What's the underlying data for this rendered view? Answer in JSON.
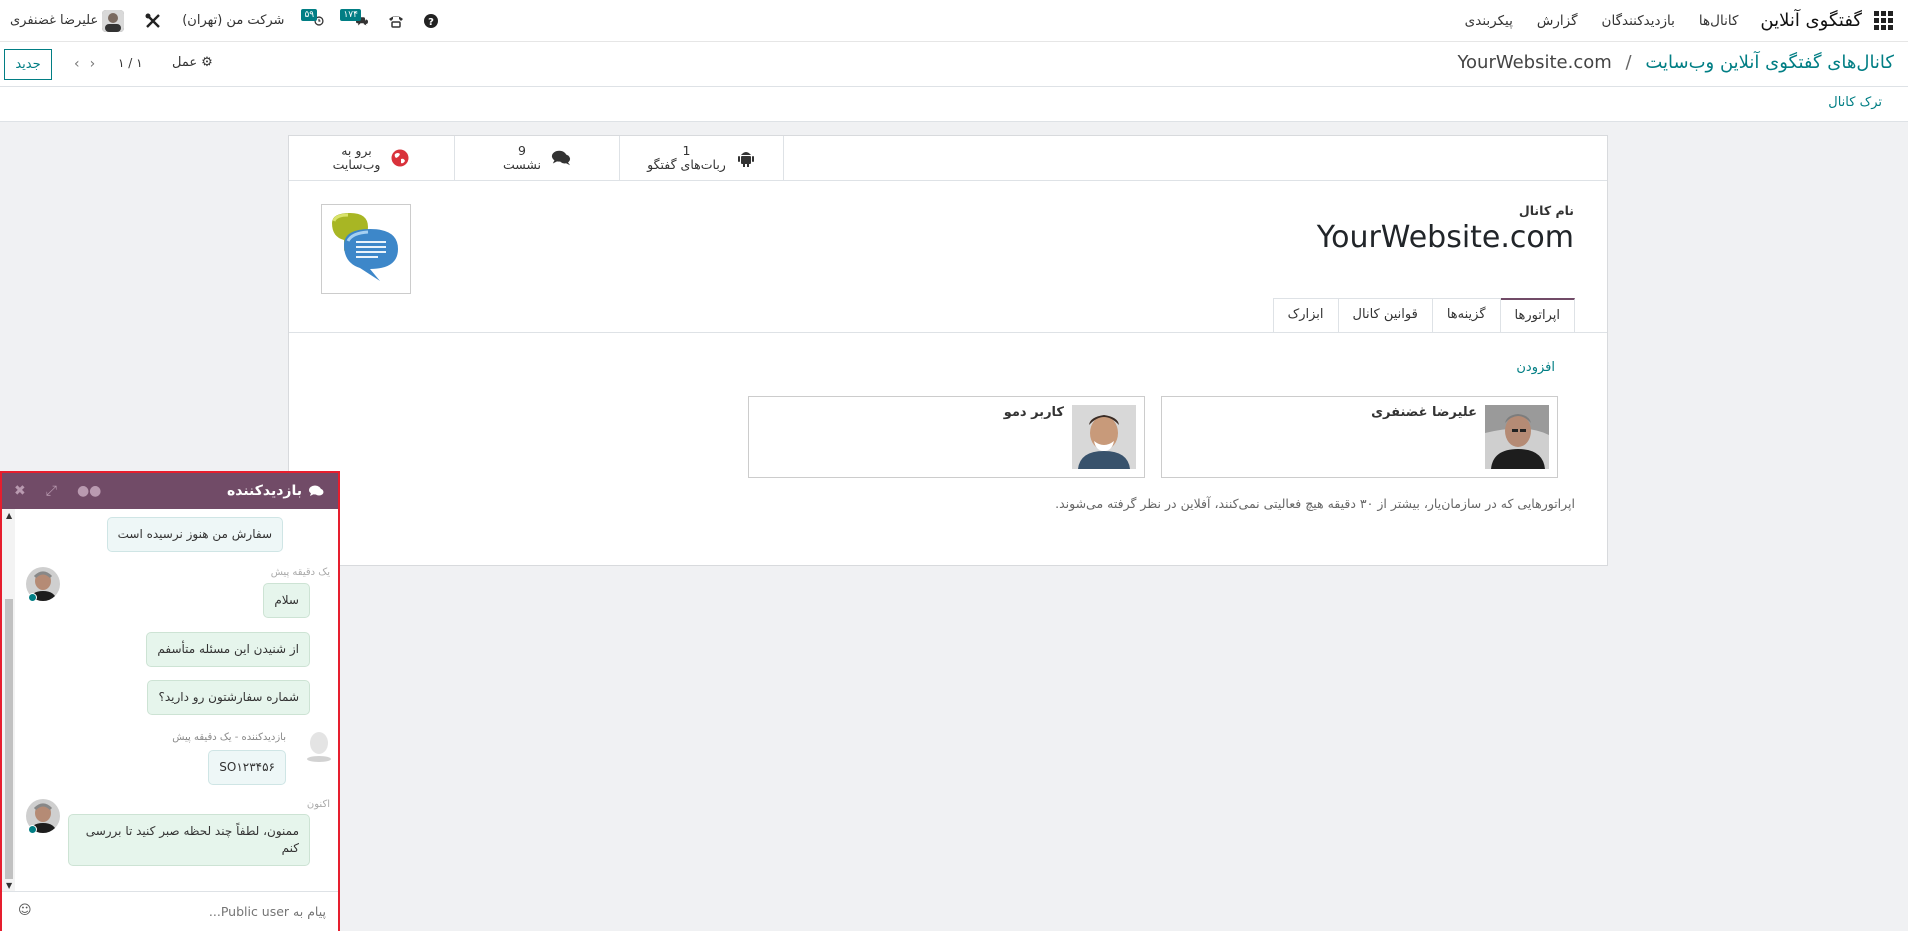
{
  "navbar": {
    "brand": "گفتگوی آنلاین",
    "menu": [
      "کانال‌ها",
      "بازدیدکنندگان",
      "گزارش",
      "پیکربندی"
    ],
    "activity_badge": "۵۹",
    "messages_badge": "۱۷۴",
    "company": "شرکت من (تهران)",
    "user_name": "علیرضا غضنفری"
  },
  "control": {
    "breadcrumb_parent": "کانال‌های گفتگوی آنلاین وب‌سایت",
    "breadcrumb_sep": "/",
    "breadcrumb_current": "YourWebsite.com",
    "new_button": "جدید",
    "pager": "۱ / ۱",
    "action_label": "عمل"
  },
  "statusbar": {
    "leave": "ترک کانال"
  },
  "stat_buttons": [
    {
      "value": "1",
      "label": "ربات‌های گفتگو",
      "icon": "android-icon"
    },
    {
      "value": "9",
      "label": "نشست",
      "icon": "comments-icon"
    },
    {
      "value": "برو به",
      "label": "وب‌سایت",
      "icon": "globe-icon"
    }
  ],
  "form": {
    "field_label": "نام کانال",
    "channel_name": "YourWebsite.com",
    "tabs": [
      "اپراتورها",
      "گزینه‌ها",
      "قوانین کانال",
      "ابزارک"
    ],
    "add": "افزودن",
    "operators": [
      "علیرضا غضنفری",
      "کاربر دمو"
    ],
    "note": "اپراتورهایی که در سازمان‌یار، بیشتر از ۳۰ دقیقه هیچ فعالیتی نمی‌کنند، آفلاین در نظر گرفته می‌شوند."
  },
  "chat": {
    "title": "بازدیدکننده",
    "messages": [
      {
        "text": "سفارش من هنوز نرسیده است"
      },
      {
        "meta": "یک دقیقه پیش"
      },
      {
        "text": "سلام"
      },
      {
        "text": "از شنیدن این مسئله متأسفم"
      },
      {
        "text": "شماره سفارشتون رو دارید؟"
      },
      {
        "meta": "بازدیدکننده - یک دقیقه پیش"
      },
      {
        "text": "SO۱۲۳۴۵۶"
      },
      {
        "meta": "اکنون"
      },
      {
        "text": "ممنون، لطفاً چند لحظه صبر کنید تا بررسی کنم"
      }
    ],
    "placeholder": "پیام به Public user..."
  },
  "colors": {
    "brand": "#714b67",
    "accent": "#017e84",
    "highlight": "#e61e2e"
  }
}
